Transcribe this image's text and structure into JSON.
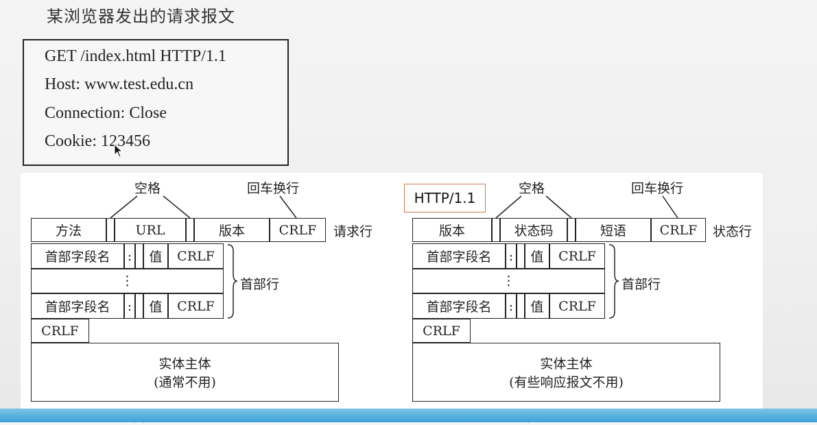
{
  "title": "某浏览器发出的请求报文",
  "request_message": {
    "lines": [
      "GET /index.html HTTP/1.1",
      "Host: www.test.edu.cn",
      "Connection: Close",
      "Cookie: 123456"
    ]
  },
  "request_diagram": {
    "label_space": "空格",
    "label_crlf_top": "回车换行",
    "request_line": {
      "method": "方法",
      "url": "URL",
      "version": "版本",
      "crlf": "CRLF",
      "side_label": "请求行"
    },
    "header_rows": [
      {
        "name": "首部字段名",
        "colon": ":",
        "value": "值",
        "crlf": "CRLF"
      },
      {
        "name": "首部字段名",
        "colon": ":",
        "value": "值",
        "crlf": "CRLF"
      }
    ],
    "ellipsis": "⋮",
    "header_side_label": "首部行",
    "blank_crlf": "CRLF",
    "body_line1": "实体主体",
    "body_line2": "(通常不用)",
    "caption": "(a) 请求报文"
  },
  "response_diagram": {
    "badge": "HTTP/1.1",
    "label_space": "空格",
    "label_crlf_top": "回车换行",
    "status_line": {
      "version": "版本",
      "status_code": "状态码",
      "phrase": "短语",
      "crlf": "CRLF",
      "side_label": "状态行"
    },
    "header_rows": [
      {
        "name": "首部字段名",
        "colon": ":",
        "value": "值",
        "crlf": "CRLF"
      },
      {
        "name": "首部字段名",
        "colon": ":",
        "value": "值",
        "crlf": "CRLF"
      }
    ],
    "ellipsis": "⋮",
    "header_side_label": "首部行",
    "blank_crlf": "CRLF",
    "body_line1": "实体主体",
    "body_line2": "(有些响应报文不用)",
    "caption": "(b) 响应报文"
  },
  "colors": {
    "badge_border": "#d07a50",
    "bottom_bar": "#3aa0d8"
  },
  "icons": {
    "cursor": "mouse-pointer-icon"
  }
}
